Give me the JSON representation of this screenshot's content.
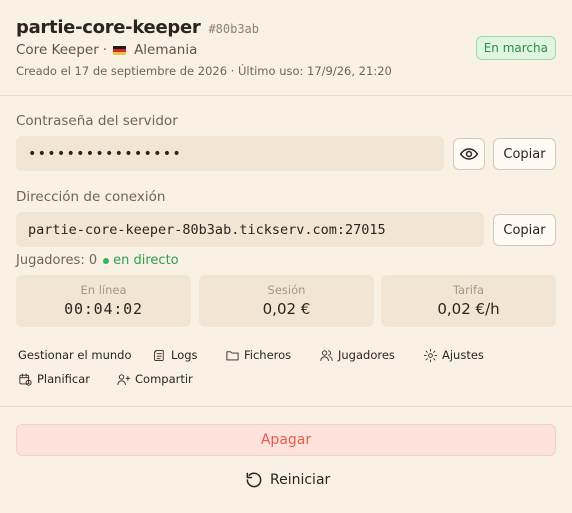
{
  "server": {
    "name": "partie-core-keeper",
    "hash": "#80b3ab",
    "game": "Core Keeper",
    "separator": "·",
    "country": "Alemania",
    "status": "En marcha",
    "meta": "Creado el 17 de septiembre de 2026 · Último uso: 17/9/26, 21:20"
  },
  "password": {
    "label": "Contraseña del servidor",
    "masked_value": "••••••••••••••••",
    "copy_label": "Copiar"
  },
  "connection": {
    "label": "Dirección de conexión",
    "address": "partie-core-keeper-80b3ab.tickserv.com:27015",
    "copy_label": "Copiar"
  },
  "players": {
    "label": "Jugadores: 0",
    "live_label": "en directo"
  },
  "stats": [
    {
      "label": "En línea",
      "value": "00:04:02"
    },
    {
      "label": "Sesión",
      "value": "0,02 €"
    },
    {
      "label": "Tarifa",
      "value": "0,02 €/h"
    }
  ],
  "actions": {
    "manage": "Gestionar el mundo",
    "logs": "Logs",
    "files": "Ficheros",
    "players": "Jugadores",
    "settings": "Ajustes",
    "schedule": "Planificar",
    "share": "Compartir"
  },
  "footer": {
    "stop_label": "Apagar",
    "restart_label": "Reiniciar"
  },
  "colors": {
    "background": "#faf1e5",
    "status_green": "#2e8d46",
    "stop_red": "#e65b4f"
  }
}
